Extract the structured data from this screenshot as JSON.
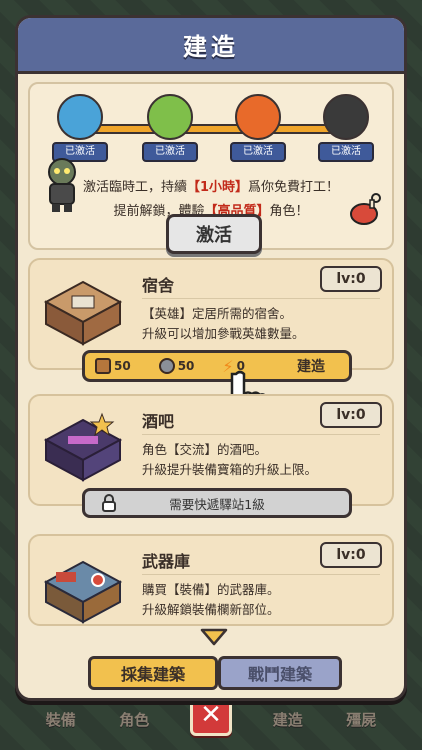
{
  "title": "建造",
  "heroes": [
    {
      "tag": "已激活",
      "color": "#4aa3d8"
    },
    {
      "tag": "已激活",
      "color": "#7fbf4a"
    },
    {
      "tag": "已激活",
      "color": "#e86a2a"
    },
    {
      "tag": "已激活",
      "color": "#3a3a3a"
    }
  ],
  "hero_section": {
    "line1_prefix": "激活臨時工，持續",
    "line1_highlight": "【1小時】",
    "line1_suffix": "爲你免費打工！",
    "line2_prefix": "提前解鎖，體驗",
    "line2_highlight": "【高品質】",
    "line2_suffix": "角色！",
    "activate_label": "激活"
  },
  "buildings": [
    {
      "name": "宿舍",
      "level": "lv:0",
      "desc_line1": "【英雄】定居所需的宿舍。",
      "desc_line2": "升級可以增加參戰英雄數量。"
    },
    {
      "name": "酒吧",
      "level": "lv:0",
      "desc_line1": "角色【交流】的酒吧。",
      "desc_line2": "升級提升裝備寶箱的升級上限。"
    },
    {
      "name": "武器庫",
      "level": "lv:0",
      "desc_line1": "購買【裝備】的武器庫。",
      "desc_line2": "升級解鎖裝備欄新部位。"
    }
  ],
  "build_bar": {
    "wood": "50",
    "stone": "50",
    "energy": "0",
    "label": "建造"
  },
  "lock_bar": {
    "label": "需要快遞驛站1級"
  },
  "tabs": {
    "gather": "採集建築",
    "battle": "戰鬥建築"
  },
  "bottom_nav": {
    "equip": "裝備",
    "role": "角色",
    "build": "建造",
    "zombie": "殭屍"
  },
  "colors": {
    "title_bar": "#5a6a9a",
    "build_bar": "#f2c14e",
    "highlight": "#c22a1a"
  }
}
